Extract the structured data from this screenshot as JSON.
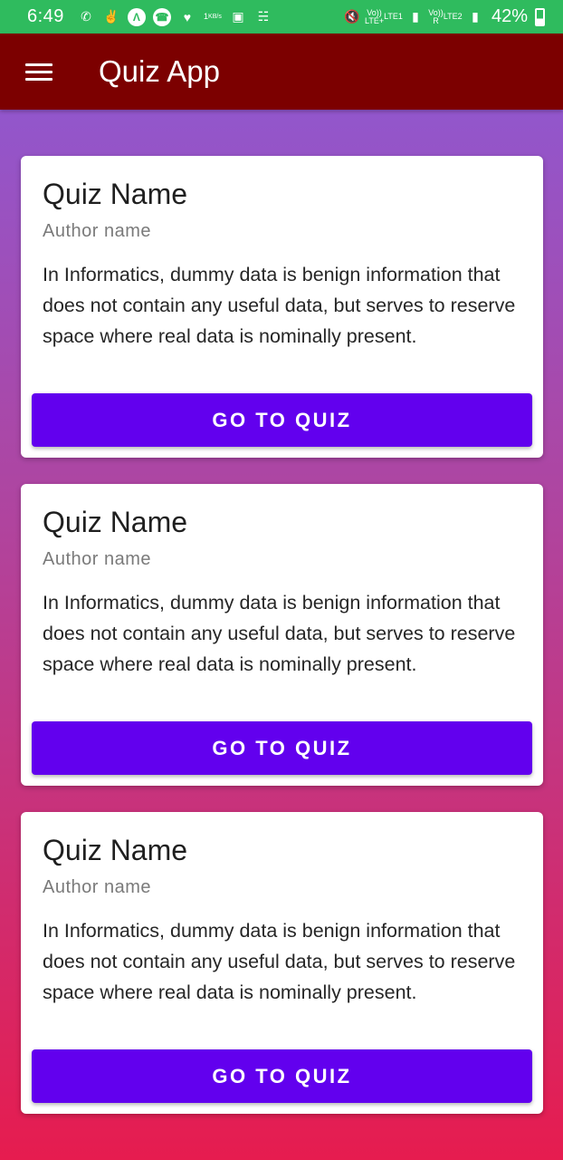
{
  "status_bar": {
    "time": "6:49",
    "network_speed_value": "1",
    "network_speed_unit": "KB/s",
    "sim1_label": "Vo)) LTE+",
    "sim1_sub": "LTE1",
    "sim2_label": "Vo)) R",
    "sim2_sub": "LTE2",
    "battery": "42%"
  },
  "app_bar": {
    "title": "Quiz App"
  },
  "cards": [
    {
      "title": "Quiz Name",
      "author": "Author name",
      "description": "In Informatics, dummy data is benign information that does not contain any useful data, but serves to reserve space where real data is nominally present.",
      "button_label": "GO TO QUIZ"
    },
    {
      "title": "Quiz Name",
      "author": "Author name",
      "description": "In Informatics, dummy data is benign information that does not contain any useful data, but serves to reserve space where real data is nominally present.",
      "button_label": "GO TO QUIZ"
    },
    {
      "title": "Quiz Name",
      "author": "Author name",
      "description": "In Informatics, dummy data is benign information that does not contain any useful data, but serves to reserve space where real data is nominally present.",
      "button_label": "GO TO QUIZ"
    }
  ],
  "colors": {
    "status_bar": "#2fbb5e",
    "app_bar": "#7c0000",
    "button": "#6200ee",
    "gradient_top": "#8a5bd8",
    "gradient_bottom": "#e61c4f"
  }
}
